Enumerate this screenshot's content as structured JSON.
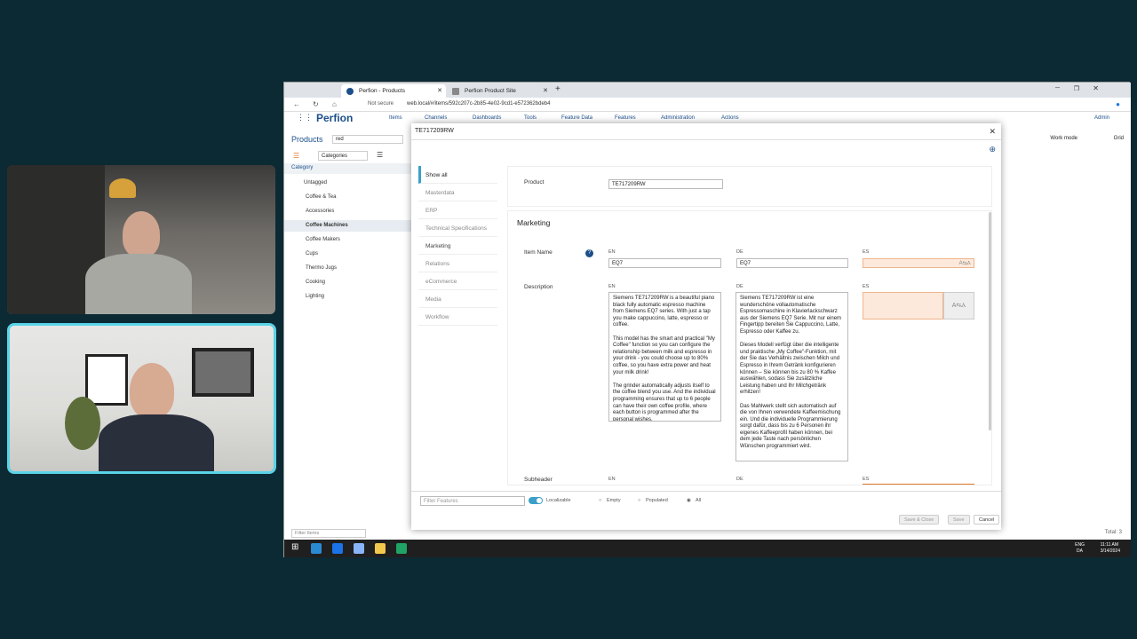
{
  "browser": {
    "tabs": [
      {
        "label": "Perfion - Products",
        "active": true
      },
      {
        "label": "Perfion Product Site",
        "active": false
      }
    ],
    "address": {
      "security": "Not secure",
      "url": "web.local/#/items/592c207c-2b85-4e02-9cd1-e572362bdeb4"
    }
  },
  "app": {
    "logo": "Perfion",
    "nav": [
      "Items",
      "Channels",
      "Dashboards",
      "Tools",
      "Feature Data",
      "Features",
      "Administration",
      "Actions"
    ],
    "user": "Admin",
    "products_label": "Products",
    "search_value": "red",
    "categories_button": "Categories",
    "work_mode_label": "Work mode",
    "work_mode_value": "Grid",
    "category_header": "Category",
    "categories": [
      "Untagged",
      "Coffee & Tea",
      "Accessories",
      "Coffee Machines",
      "Coffee Makers",
      "Cups",
      "Thermo Jugs",
      "Cooking",
      "Lighting"
    ],
    "filter_items_placeholder": "Filter Items",
    "total": "Total: 3"
  },
  "dialog": {
    "title": "TE717209RW",
    "menu": [
      "Show all",
      "Masterdata",
      "ERP",
      "Technical Specifications",
      "Marketing",
      "Relations",
      "eCommerce",
      "Media",
      "Workflow"
    ],
    "product_label": "Product",
    "product_value": "TE717209RW",
    "section": "Marketing",
    "item_name_label": "Item Name",
    "description_label": "Description",
    "subheader_label": "Subheader",
    "lang_en": "EN",
    "lang_de": "DE",
    "lang_es": "ES",
    "item_name_en": "EQ7",
    "item_name_de": "EQ7",
    "desc_en": "Siemens TE717209RW is a beautiful piano black fully automatic espresso machine from Siemens EQ7 series. With just a tap you make cappuccino, latte, espresso or coffee.\n\nThis model has the smart and practical \"My Coffee\" function so you can configure the relationship between milk and espresso in your drink - you could choose up to 80% coffee, so you have extra power and heat your milk drink!\n\nThe grinder automatically adjusts itself to the coffee blend you use. And the individual programming ensures that up to 6 people can have their own coffee profile, where each button is programmed after the personal wishes.",
    "desc_de": "Siemens TE717209RW ist eine wunderschöne vollautomatische Espressomaschine in Klavierlackschwarz aus der Siemens EQ7 Serie. Mit nur einem Fingertipp bereiten Sie Cappuccino, Latte, Espresso oder Kaffee zu.\n\nDieses Modell verfügt über die intelligente und praktische „My Coffee\"-Funktion, mit der Sie das Verhältnis zwischen Milch und Espresso in Ihrem Getränk konfigurieren können – Sie können bis zu 80 % Kaffee auswählen, sodass Sie zusätzliche Leistung haben und Ihr Milchgetränk erhitzen!\n\nDas Mahlwerk stellt sich automatisch auf die von Ihnen verwendete Kaffeemischung ein. Und die individuelle Programmierung sorgt dafür, dass bis zu 6 Personen ihr eigenes Kaffeeprofil haben können, bei dem jede Taste nach persönlichen Wünschen programmiert wird.",
    "filter_features_placeholder": "Filter Features",
    "localizable_label": "Localizable",
    "radio_empty": "Empty",
    "radio_populated": "Populated",
    "radio_all": "All",
    "save_close": "Save & Close",
    "save": "Save",
    "cancel": "Cancel"
  },
  "taskbar": {
    "lang": "ENG",
    "region": "DA",
    "time": "11:11 AM",
    "date": "3/14/2024"
  },
  "colors": {
    "accent": "#3aa0c8",
    "brand": "#1c4f8a",
    "es_field": "#fde9db"
  }
}
